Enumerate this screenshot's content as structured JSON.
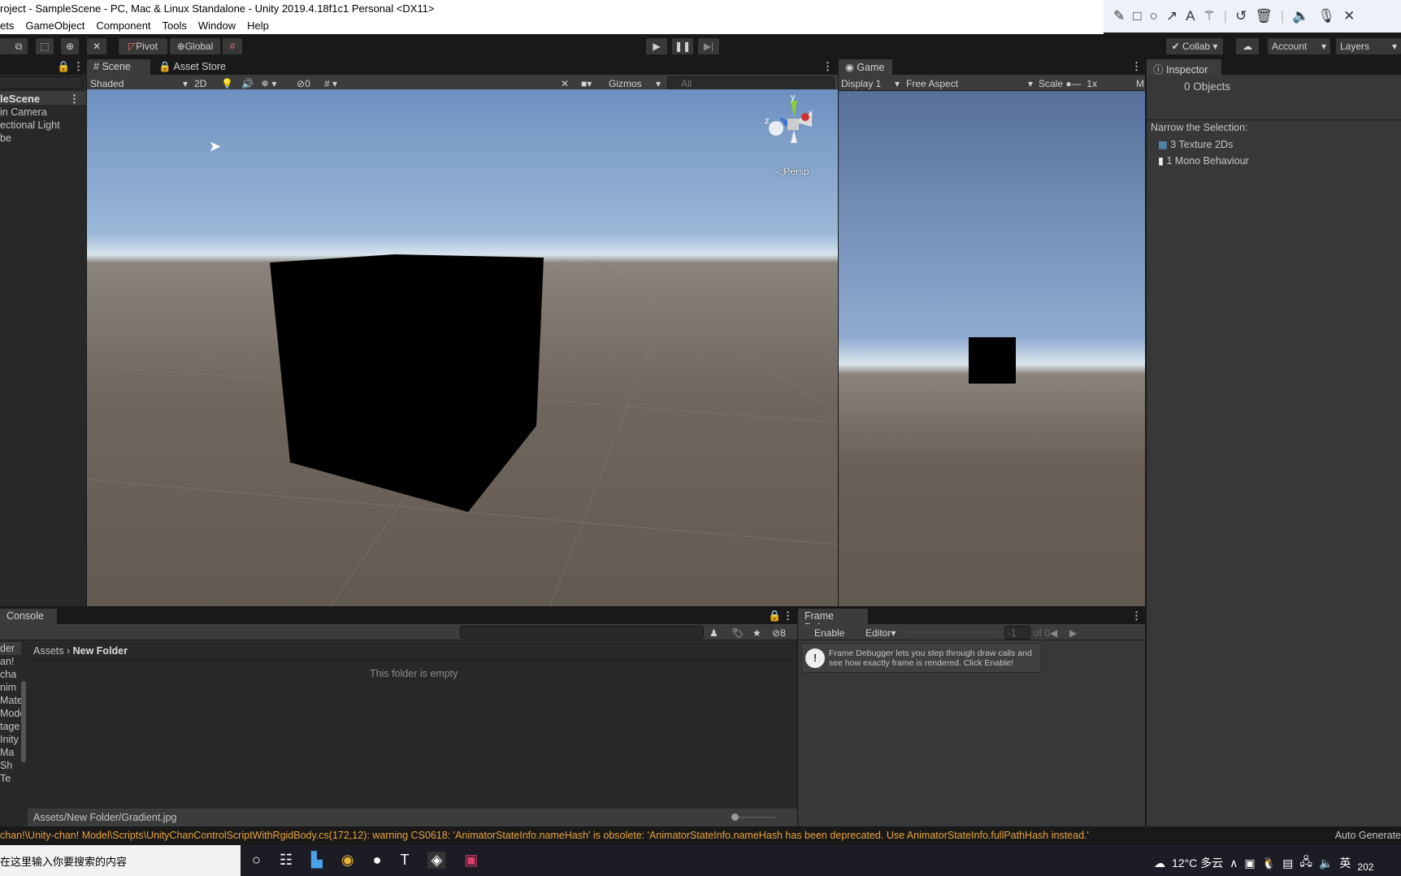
{
  "window": {
    "title": "roject - SampleScene - PC, Mac & Linux Standalone - Unity 2019.4.18f1c1 Personal <DX11>"
  },
  "menu": [
    "ets",
    "GameObject",
    "Component",
    "Tools",
    "Window",
    "Help"
  ],
  "annotation_tools": [
    "pencil-icon",
    "rectangle-icon",
    "circle-icon",
    "arrow-icon",
    "text-icon",
    "magic-wand-icon",
    "undo-icon",
    "trash-icon",
    "speaker-icon",
    "microphone-icon",
    "close-icon"
  ],
  "toolbar": {
    "pivot": "Pivot",
    "global": "Global",
    "collab": "Collab",
    "account": "Account",
    "layers": "Layers"
  },
  "hierarchy": {
    "scene": "leScene",
    "items": [
      "in Camera",
      "ectional Light",
      "be"
    ]
  },
  "scene": {
    "tabs": [
      "Scene",
      "Asset Store"
    ],
    "shading": "Shaded",
    "mode_2d": "2D",
    "hidden_count": "0",
    "gizmos": "Gizmos",
    "search_placeholder": "All",
    "axis_y": "y",
    "axis_x": "x",
    "axis_z": "z",
    "persp": "Persp"
  },
  "game": {
    "tab": "Game",
    "display": "Display 1",
    "aspect": "Free Aspect",
    "scale_label": "Scale",
    "scale_value": "1x",
    "maximize": "M"
  },
  "inspector": {
    "tab": "Inspector",
    "objects": "0 Objects",
    "narrow": "Narrow the Selection:",
    "items": [
      "3 Texture 2Ds",
      "1 Mono Behaviour"
    ]
  },
  "console": {
    "tab": "Console",
    "hidden_count": "8"
  },
  "project": {
    "breadcrumb": [
      "Assets",
      "New Folder"
    ],
    "empty": "This folder is empty",
    "path": "Assets/New Folder/Gradient.jpg",
    "tree": [
      "der",
      "",
      "an!",
      "cha",
      "",
      "nim",
      "Mate",
      "Mode",
      "tage",
      "Inity",
      "Ma",
      "Sh",
      "Te"
    ]
  },
  "frame_debug": {
    "tab": "Frame Debug",
    "enable": "Enable",
    "editor": "Editor",
    "frame": "-1",
    "of": "of 0",
    "message": "Frame Debugger lets you step through draw calls and see how exactly frame is rendered. Click Enable!"
  },
  "status": {
    "message": "chan!\\Unity-chan! Model\\Scripts\\UnityChanControlScriptWithRgidBody.cs(172,12): warning CS0618: 'AnimatorStateInfo.nameHash' is obsolete: 'AnimatorStateInfo.nameHash has been deprecated. Use AnimatorStateInfo.fullPathHash instead.'",
    "right": "Auto Generate"
  },
  "taskbar": {
    "search": "在这里输入你要搜索的内容",
    "weather": "12°C 多云",
    "ime": "英",
    "clock": "202"
  },
  "colors": {
    "warning": "#e8a33d",
    "accent": "#3d7ab8"
  }
}
